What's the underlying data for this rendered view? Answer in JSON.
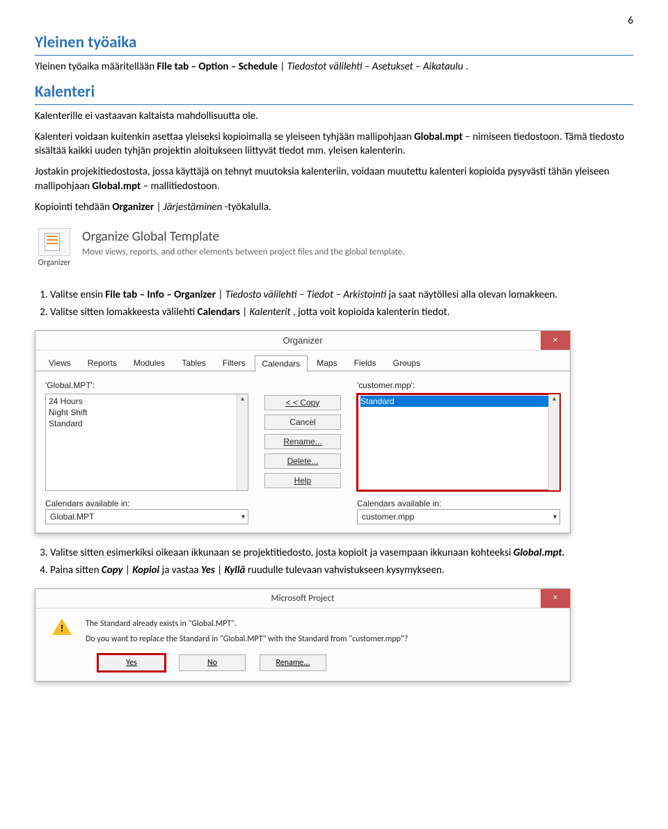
{
  "page_number": "6",
  "h1_yleinen": "Yleinen työaika",
  "p_yleinen": {
    "pre": "Yleinen työaika määritellään ",
    "b1": "File tab – Option – Schedule",
    "sep": " | ",
    "i1": "Tiedostot välilehti – Asetukset – Aikataulu",
    "suf": "."
  },
  "h1_kalenteri": "Kalenteri",
  "p_k1": "Kalenterille ei vastaavan kaltaista mahdollisuutta ole.",
  "p_k2": {
    "pre": "Kalenteri voidaan kuitenkin asettaa yleiseksi kopioimalla se yleiseen tyhjään mallipohjaan ",
    "b1": "Global.mpt",
    "suf": " – nimiseen tiedostoon. Tämä tiedosto sisältää kaikki uuden tyhjän projektin aloitukseen liittyvät tiedot mm. yleisen kalenterin."
  },
  "p_k3": {
    "pre": "Jostakin projekitiedostosta, jossa käyttäjä on tehnyt muutoksia kalenteriin, voidaan muutettu kalenteri kopioida pysyvästi tähän yleiseen mallipohjaan ",
    "b1": "Global.mpt",
    "suf": " – mallitiedostoon."
  },
  "p_k4": {
    "pre": "Kopiointi tehdään ",
    "b1": "Organizer",
    "sep": " | ",
    "i1": "Järjestäminen",
    "suf": " -työkalulla."
  },
  "ogt": {
    "icon_label": "Organizer",
    "title": "Organize Global Template",
    "desc": "Move views, reports, and other elements between project files and the global template."
  },
  "steps1": {
    "s1": {
      "pre": "Valitse ensin ",
      "b1": "File tab – Info – Organizer",
      "sep": " | ",
      "i1": "Tiedosto välilehti – Tiedot – Arkistointi",
      "suf": " ja saat näytöllesi alla olevan lomakkeen."
    },
    "s2": {
      "pre": "Valitse sitten lomakkeesta välilehti ",
      "b1": "Calendars",
      "sep": " | ",
      "i1": "Kalenterit",
      "suf": ", jotta voit kopioida kalenterin tiedot."
    }
  },
  "organizer": {
    "title": "Organizer",
    "close": "×",
    "tabs": [
      "Views",
      "Reports",
      "Modules",
      "Tables",
      "Filters",
      "Calendars",
      "Maps",
      "Fields",
      "Groups"
    ],
    "active_tab": "Calendars",
    "left_label": "'Global.MPT':",
    "right_label": "'customer.mpp':",
    "left_items": [
      "24 Hours",
      "Night Shift",
      "Standard"
    ],
    "right_items": [
      "Standard"
    ],
    "right_selected": "Standard",
    "buttons": [
      "< < Copy",
      "Cancel",
      "Rename...",
      "Delete...",
      "Help"
    ],
    "avail_left_label": "Calendars available in:",
    "avail_right_label": "Calendars available in:",
    "avail_left_value": "Global.MPT",
    "avail_right_value": "customer.mpp"
  },
  "steps2": {
    "s3": {
      "pre": "Valitse sitten esimerkiksi oikeaan ikkunaan se projektitiedosto, josta kopioit ja vasempaan ikkunaan kohteeksi ",
      "bi1": "Global.mpt.",
      "suf": ""
    },
    "s4": {
      "pre": "Paina sitten ",
      "bi1": "Copy",
      "sep1": " | ",
      "bi2": "Kopioi",
      "mid": " ja vastaa ",
      "bi3": "Yes",
      "sep2": " | ",
      "bi4": "Kyllä",
      "suf": " ruudulle tulevaan vahvistukseen kysymykseen."
    }
  },
  "confirm": {
    "title": "Microsoft Project",
    "close": "×",
    "line1": "The  Standard already exists in \"Global.MPT\".",
    "line2": "Do you want to replace the  Standard in \"Global.MPT\" with the  Standard from \"customer.mpp\"?",
    "buttons": {
      "yes": "Yes",
      "no": "No",
      "rename": "Rename..."
    }
  }
}
